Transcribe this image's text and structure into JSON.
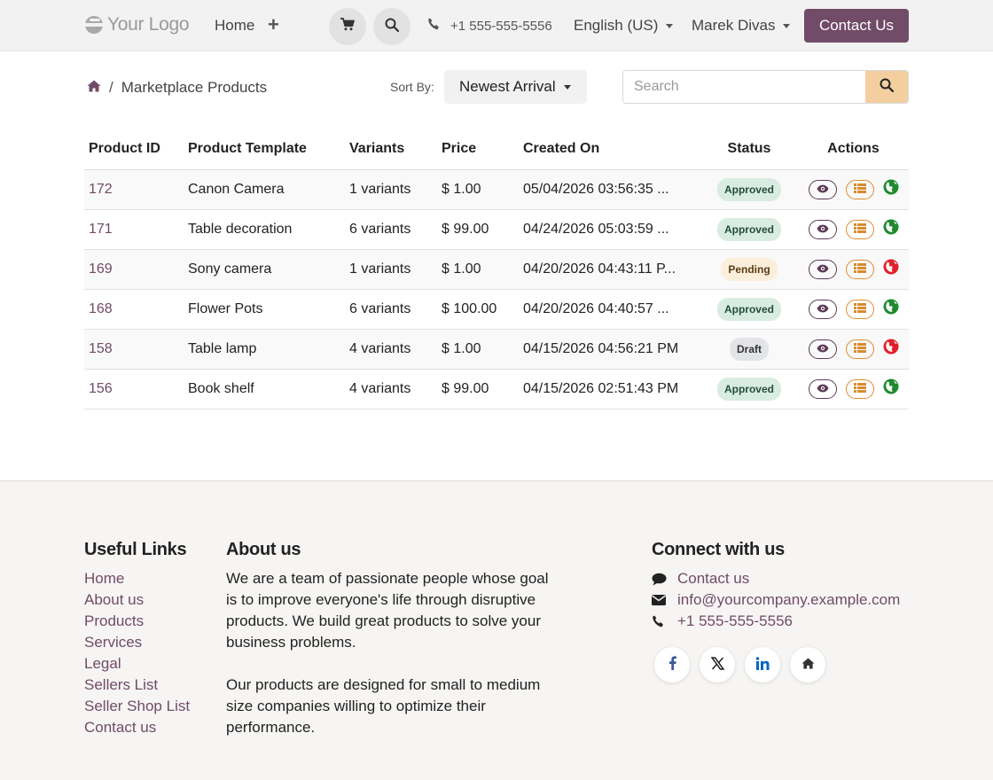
{
  "header": {
    "logo_text": "Your Logo",
    "nav_home": "Home",
    "nav_plus": "+",
    "phone": "+1 555-555-5556",
    "language": "English (US)",
    "user": "Marek Divas",
    "contact_button": "Contact Us"
  },
  "toolbar": {
    "breadcrumb_separator": "/",
    "breadcrumb_current": "Marketplace Products",
    "sort_label": "Sort By:",
    "sort_value": "Newest Arrival",
    "search_placeholder": "Search"
  },
  "table": {
    "columns": [
      "Product ID",
      "Product Template",
      "Variants",
      "Price",
      "Created On",
      "Status",
      "Actions"
    ],
    "rows": [
      {
        "id": "172",
        "template": "Canon Camera",
        "variants": "1 variants",
        "price": "$ 1.00",
        "created": "05/04/2026 03:56:35 ...",
        "status": "Approved",
        "published": true
      },
      {
        "id": "171",
        "template": "Table decoration",
        "variants": "6 variants",
        "price": "$ 99.00",
        "created": "04/24/2026 05:03:59 ...",
        "status": "Approved",
        "published": true
      },
      {
        "id": "169",
        "template": "Sony camera",
        "variants": "1 variants",
        "price": "$ 1.00",
        "created": "04/20/2026 04:43:11 P...",
        "status": "Pending",
        "published": false
      },
      {
        "id": "168",
        "template": "Flower Pots",
        "variants": "6 variants",
        "price": "$ 100.00",
        "created": "04/20/2026 04:40:57 ...",
        "status": "Approved",
        "published": true
      },
      {
        "id": "158",
        "template": "Table lamp",
        "variants": "4 variants",
        "price": "$ 1.00",
        "created": "04/15/2026 04:56:21 PM",
        "status": "Draft",
        "published": false
      },
      {
        "id": "156",
        "template": "Book shelf",
        "variants": "4 variants",
        "price": "$ 99.00",
        "created": "04/15/2026 02:51:43 PM",
        "status": "Approved",
        "published": true
      }
    ]
  },
  "footer": {
    "useful_links_title": "Useful Links",
    "useful_links": [
      "Home",
      "About us",
      "Products",
      "Services",
      "Legal",
      "Sellers List",
      "Seller Shop List",
      "Contact us"
    ],
    "about_title": "About us",
    "about_p1": "We are a team of passionate people whose goal is to improve everyone's life through disruptive products. We build great products to solve your business problems.",
    "about_p2": "Our products are designed for small to medium size companies willing to optimize their performance.",
    "connect_title": "Connect with us",
    "connect_contact": "Contact us",
    "connect_email": "info@yourcompany.example.com",
    "connect_phone": "+1 555-555-5556",
    "social_icons": [
      "facebook-icon",
      "x-twitter-icon",
      "linkedin-icon",
      "home-icon"
    ]
  },
  "colors": {
    "brand": "#714b67",
    "search_button": "#f3cfa0",
    "approved_bg": "#d9ece2",
    "pending_bg": "#fbeedb",
    "draft_bg": "#e2e4e8",
    "published_globe": "#1e8a2e",
    "unpublished_globe": "#e0202a"
  }
}
